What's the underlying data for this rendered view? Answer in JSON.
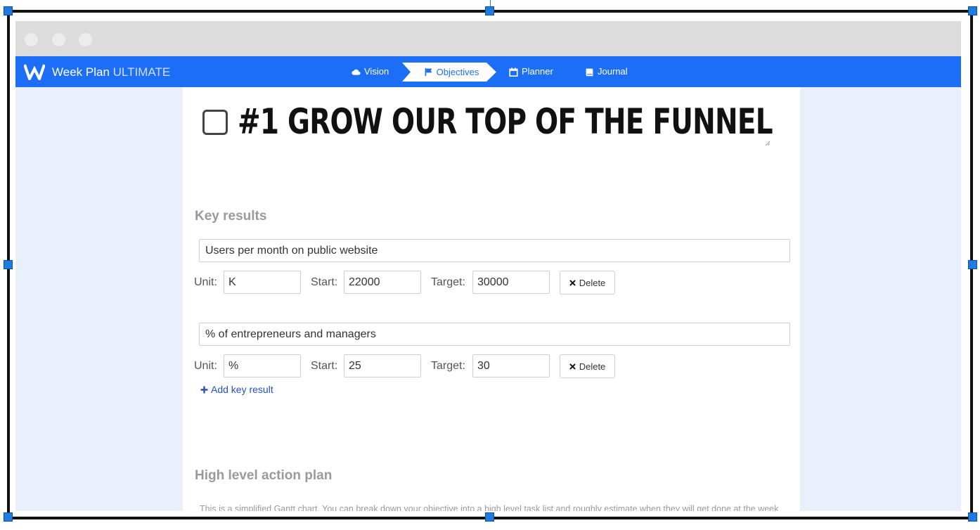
{
  "app": {
    "brand_main": "Week Plan",
    "brand_accent": "ULTIMATE",
    "colors": {
      "nav": "#1c6ef7",
      "background": "#e9f0fb",
      "link": "#2153b8"
    }
  },
  "nav": {
    "items": [
      {
        "label": "Vision",
        "icon": "cloud-icon"
      },
      {
        "label": "Objectives",
        "icon": "flag-icon",
        "active": true
      },
      {
        "label": "Planner",
        "icon": "calendar-icon"
      },
      {
        "label": "Journal",
        "icon": "book-icon"
      }
    ]
  },
  "objective": {
    "title": "#1 GROW OUR TOP OF THE FUNNEL",
    "completed": false
  },
  "key_results": {
    "heading": "Key results",
    "unit_label": "Unit:",
    "start_label": "Start:",
    "target_label": "Target:",
    "delete_label": "Delete",
    "items": [
      {
        "name": "Users per month on public website",
        "unit": "K",
        "start": "22000",
        "target": "30000"
      },
      {
        "name": "% of entrepreneurs and managers",
        "unit": "%",
        "start": "25",
        "target": "30"
      }
    ],
    "add_label": "Add key result"
  },
  "action_plan": {
    "heading": "High level action plan",
    "description": "This is a simplified Gantt chart. You can break down your objective into a high level task list and roughly estimate when they will get done at the week level by clicking on the cells on the right. The tasks will appear in the High Impact Tasks section in the planner in the corresponding weeks."
  }
}
